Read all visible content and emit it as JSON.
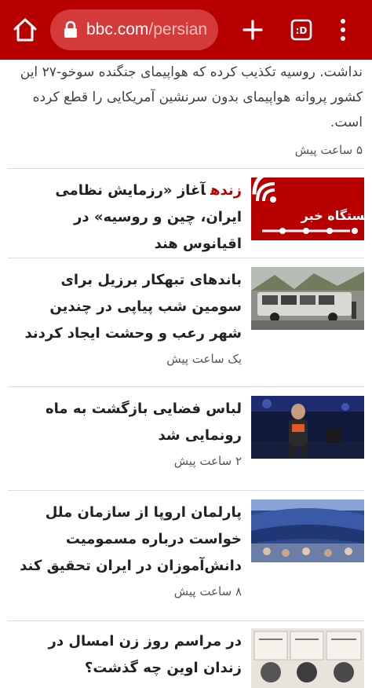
{
  "browser": {
    "url_host": "bbc.com",
    "url_path": "/persian",
    "tab_count_label": ":D"
  },
  "lead": {
    "text": "نداشت. روسیه تکذیب کرده که هواپیمای جنگنده سوخو-۲۷ این کشور پروانه هواپیمای بدون سرنشین آمریکایی را قطع کرده است.",
    "time": "۵ ساعت پیش"
  },
  "stories": [
    {
      "live_label": "زنده",
      "headline": "آغاز «رزمایش نظامی ایران، چین و روسیه» در اقیانوس هند",
      "thumb_label": "ایستگاه خبر",
      "time": ""
    },
    {
      "headline": "باندهای تبهکار برزیل برای سومین شب پیاپی در چندین شهر رعب و وحشت ایجاد کردند",
      "time": "یک ساعت پیش"
    },
    {
      "headline": "لباس فضایی بازگشت به ماه رونمایی شد",
      "time": "۲ ساعت پیش"
    },
    {
      "headline": "پارلمان اروپا از سازمان ملل خواست درباره مسمومیت دانش‌آموزان در ایران تحقیق کند",
      "time": "۸ ساعت پیش"
    },
    {
      "headline": "در مراسم روز زن امسال در زندان اوین چه گذشت؟",
      "time": ""
    }
  ]
}
